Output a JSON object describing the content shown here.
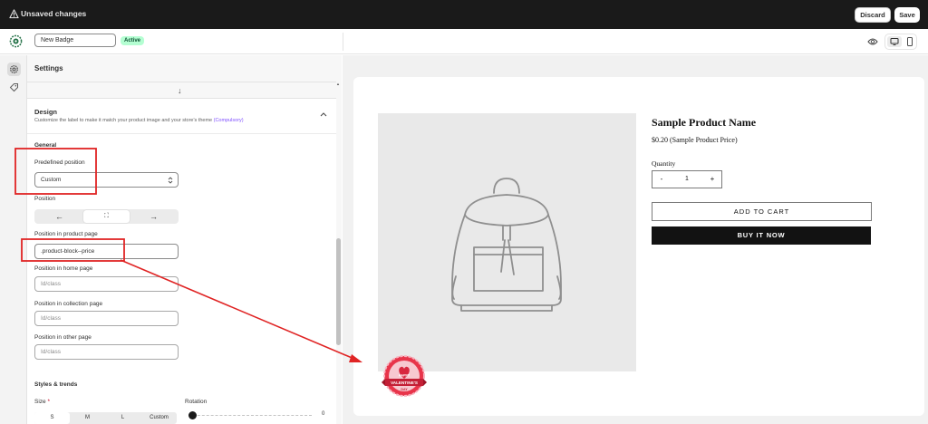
{
  "topbar": {
    "title": "Unsaved changes",
    "discard_label": "Discard",
    "save_label": "Save"
  },
  "header": {
    "badge_name": "New Badge",
    "status": "Active"
  },
  "panel": {
    "settings_title": "Settings",
    "design": {
      "title": "Design",
      "subtitle": "Customize the label to make it match your product image and your store's theme",
      "subtitle_link": "(Compulsory)"
    },
    "general_title": "General",
    "predefined_position_label": "Predefined position",
    "predefined_position_value": "Custom",
    "position_label": "Position",
    "position_options": [
      "←",
      "⛶",
      "→"
    ],
    "product_page_label": "Position in product page",
    "product_page_value": ".product-block--price",
    "home_page_label": "Position in home page",
    "home_page_placeholder": "Id/class",
    "collection_page_label": "Position in collection page",
    "collection_page_placeholder": "Id/class",
    "other_page_label": "Position in other page",
    "other_page_placeholder": "Id/class",
    "styles_title": "Styles & trends",
    "size_label": "Size",
    "size_required": "*",
    "size_options": [
      "S",
      "M",
      "L",
      "Custom"
    ],
    "rotation_label": "Rotation",
    "rotation_value": "0"
  },
  "preview": {
    "product_name": "Sample Product Name",
    "product_price": "$0.20 (Sample Product Price)",
    "quantity_label": "Quantity",
    "qty_minus": "-",
    "qty_value": "1",
    "qty_plus": "+",
    "add_to_cart": "ADD TO CART",
    "buy_now": "BUY IT NOW",
    "badge": {
      "line1": "HAPPY",
      "line2": "VALENTINE'S",
      "line3": "DAY"
    }
  },
  "colors": {
    "annotation_red": "#e02424",
    "active_badge_bg": "#b4fed2",
    "topbar_bg": "#1a1a1a",
    "link_purple": "#8051ff"
  },
  "icons": [
    "warning-icon",
    "app-logo-icon",
    "eye-icon",
    "desktop-icon",
    "mobile-icon",
    "gear-icon",
    "tag-icon",
    "arrow-down-icon",
    "chevron-up-icon",
    "select-chevron-icon",
    "backpack-image"
  ]
}
